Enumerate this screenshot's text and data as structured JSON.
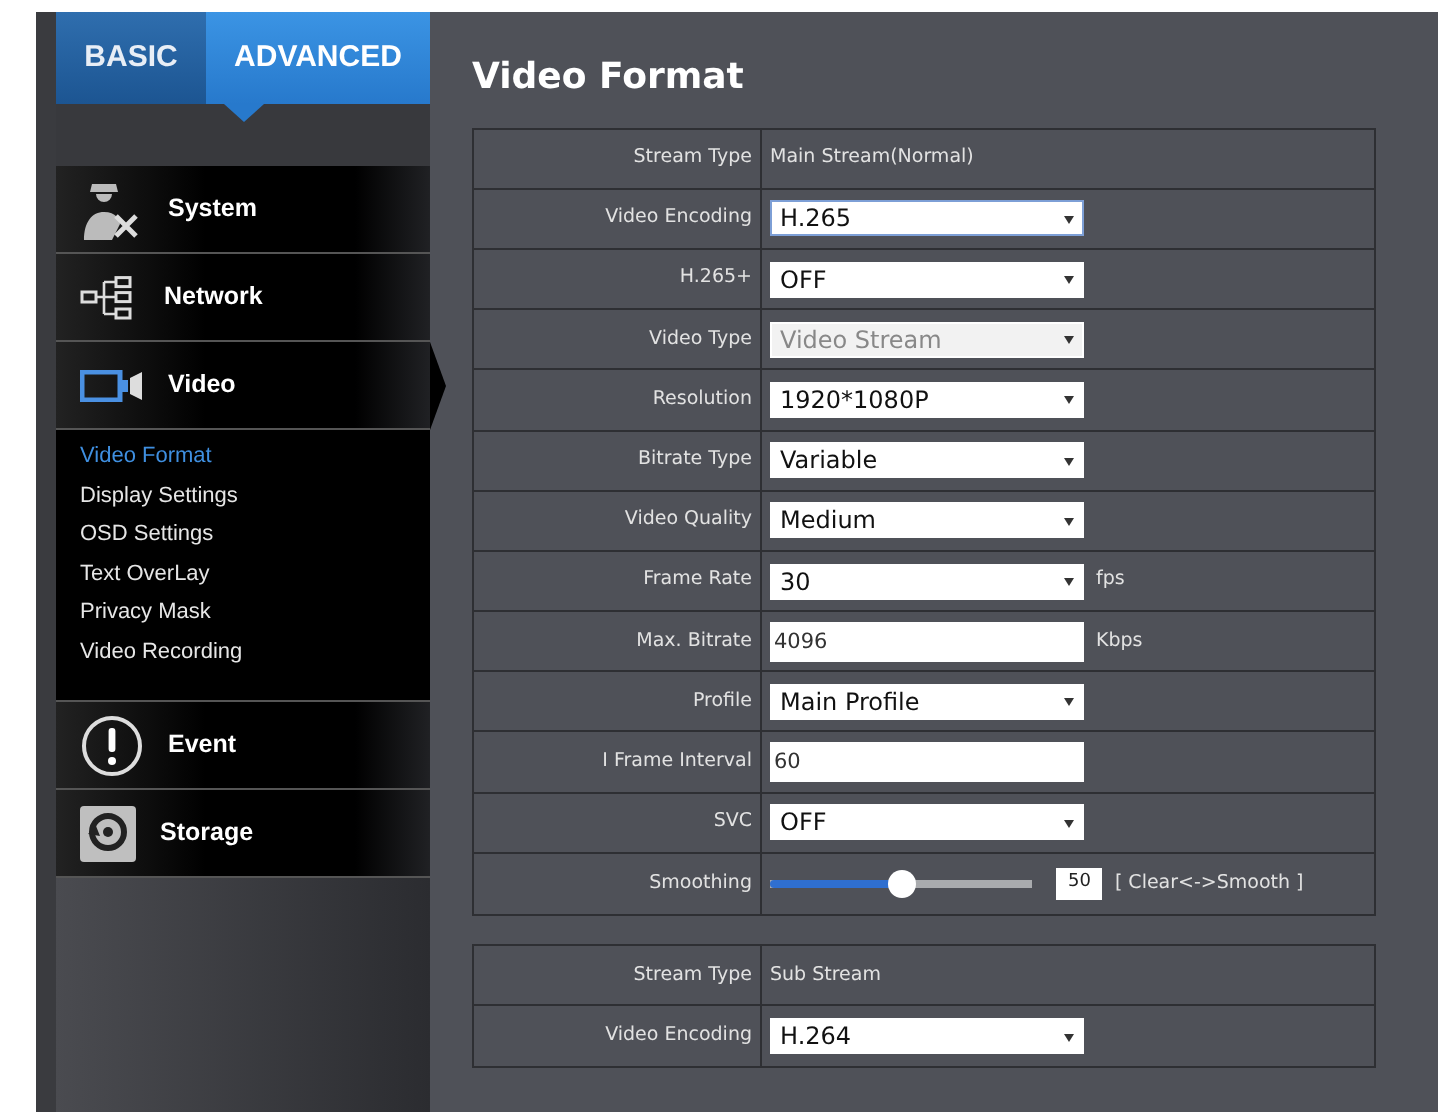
{
  "tabs": [
    {
      "label": "BASIC",
      "selected": false
    },
    {
      "label": "ADVANCED",
      "selected": true
    }
  ],
  "sidebar": {
    "items": [
      {
        "label": "System",
        "expanded": false
      },
      {
        "label": "Network",
        "expanded": false
      },
      {
        "label": "Video",
        "expanded": true,
        "children": [
          {
            "label": "Video Format",
            "selected": true
          },
          {
            "label": "Display Settings",
            "selected": false
          },
          {
            "label": "OSD Settings",
            "selected": false
          },
          {
            "label": "Text OverLay",
            "selected": false
          },
          {
            "label": "Privacy Mask",
            "selected": false
          },
          {
            "label": "Video Recording",
            "selected": false
          }
        ]
      },
      {
        "label": "Event",
        "expanded": false
      },
      {
        "label": "Storage",
        "expanded": false
      }
    ]
  },
  "page_title": "Video Format",
  "sections": [
    {
      "rows": [
        {
          "kind": "text",
          "label": "Stream Type",
          "value": "Main Stream(Normal)"
        },
        {
          "kind": "select",
          "label": "Video Encoding",
          "value": "H.265",
          "focused": true,
          "disabled": false
        },
        {
          "kind": "select",
          "label": "H.265+",
          "value": "OFF",
          "focused": false,
          "disabled": false
        },
        {
          "kind": "select",
          "label": "Video Type",
          "value": "Video Stream",
          "focused": false,
          "disabled": true
        },
        {
          "kind": "select",
          "label": "Resolution",
          "value": "1920*1080P",
          "focused": false,
          "disabled": false
        },
        {
          "kind": "select",
          "label": "Bitrate Type",
          "value": "Variable",
          "focused": false,
          "disabled": false
        },
        {
          "kind": "select",
          "label": "Video Quality",
          "value": "Medium",
          "focused": false,
          "disabled": false
        },
        {
          "kind": "select",
          "label": "Frame Rate",
          "value": "30",
          "focused": false,
          "disabled": false,
          "unit": "fps"
        },
        {
          "kind": "input",
          "label": "Max. Bitrate",
          "value": "4096",
          "unit": "Kbps"
        },
        {
          "kind": "select",
          "label": "Profile",
          "value": "Main Profile",
          "focused": false,
          "disabled": false
        },
        {
          "kind": "input",
          "label": "I Frame Interval",
          "value": "60"
        },
        {
          "kind": "select",
          "label": "SVC",
          "value": "OFF",
          "focused": false,
          "disabled": false
        },
        {
          "kind": "slider",
          "label": "Smoothing",
          "level": 0.5,
          "reading": "50",
          "hint": "[ Clear<->Smooth ]"
        }
      ]
    },
    {
      "rows": [
        {
          "kind": "text",
          "label": "Stream Type",
          "value": "Sub Stream"
        },
        {
          "kind": "select",
          "label": "Video Encoding",
          "value": "H.264",
          "focused": false,
          "disabled": false
        }
      ]
    }
  ]
}
